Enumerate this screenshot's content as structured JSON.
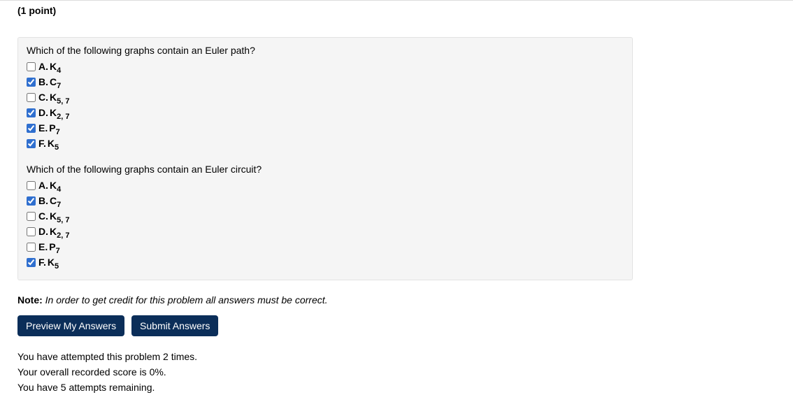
{
  "points_label": "(1 point)",
  "q1": {
    "prompt": "Which of the following graphs contain an Euler path?",
    "options": [
      {
        "letter": "A.",
        "base": "K",
        "sub": "4",
        "checked": false
      },
      {
        "letter": "B.",
        "base": "C",
        "sub": "7",
        "checked": true
      },
      {
        "letter": "C.",
        "base": "K",
        "sub": "5, 7",
        "checked": false
      },
      {
        "letter": "D.",
        "base": "K",
        "sub": "2, 7",
        "checked": true
      },
      {
        "letter": "E.",
        "base": "P",
        "sub": "7",
        "checked": true
      },
      {
        "letter": "F.",
        "base": "K",
        "sub": "5",
        "checked": true
      }
    ]
  },
  "q2": {
    "prompt": "Which of the following graphs contain an Euler circuit?",
    "options": [
      {
        "letter": "A.",
        "base": "K",
        "sub": "4",
        "checked": false
      },
      {
        "letter": "B.",
        "base": "C",
        "sub": "7",
        "checked": true
      },
      {
        "letter": "C.",
        "base": "K",
        "sub": "5, 7",
        "checked": false
      },
      {
        "letter": "D.",
        "base": "K",
        "sub": "2, 7",
        "checked": false
      },
      {
        "letter": "E.",
        "base": "P",
        "sub": "7",
        "checked": false
      },
      {
        "letter": "F.",
        "base": "K",
        "sub": "5",
        "checked": true
      }
    ]
  },
  "note": {
    "lead": "Note:",
    "body": " In order to get credit for this problem all answers must be correct."
  },
  "buttons": {
    "preview": "Preview My Answers",
    "submit": "Submit Answers"
  },
  "status": {
    "attempts": "You have attempted this problem 2 times.",
    "score": "Your overall recorded score is 0%.",
    "remaining": "You have 5 attempts remaining."
  }
}
